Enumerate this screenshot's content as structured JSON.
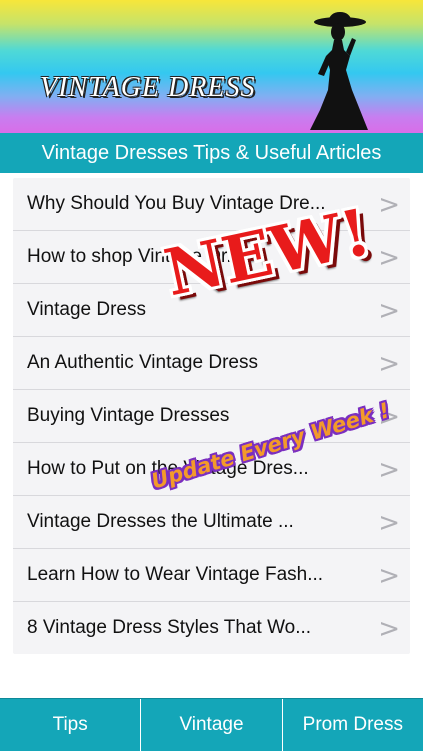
{
  "banner": {
    "app_title": "VINTAGE DRESS",
    "logo_icon": "dress-lady-silhouette-icon"
  },
  "header": {
    "title": "Vintage Dresses Tips & Useful Articles"
  },
  "articles": {
    "items": [
      {
        "label": "Why Should You Buy Vintage Dre..."
      },
      {
        "label": "How to shop Vintage Dr..."
      },
      {
        "label": "Vintage Dress"
      },
      {
        "label": "An Authentic Vintage Dress"
      },
      {
        "label": "Buying Vintage Dresses"
      },
      {
        "label": "How to Put on the Vintage Dres..."
      },
      {
        "label": "Vintage Dresses the Ultimate ..."
      },
      {
        "label": "Learn How to Wear Vintage Fash..."
      },
      {
        "label": "8 Vintage Dress Styles That Wo..."
      }
    ],
    "chevron": ">"
  },
  "badges": {
    "new_label": "NEW!",
    "update_label": "Update Every Week !"
  },
  "tabbar": {
    "tabs": [
      {
        "label": "Tips"
      },
      {
        "label": "Vintage"
      },
      {
        "label": "Prom Dress"
      }
    ]
  },
  "colors": {
    "accent": "#14a6b8",
    "new_red": "#e81b1b",
    "update_orange": "#f39a2a",
    "update_purple": "#7b2fc0"
  }
}
